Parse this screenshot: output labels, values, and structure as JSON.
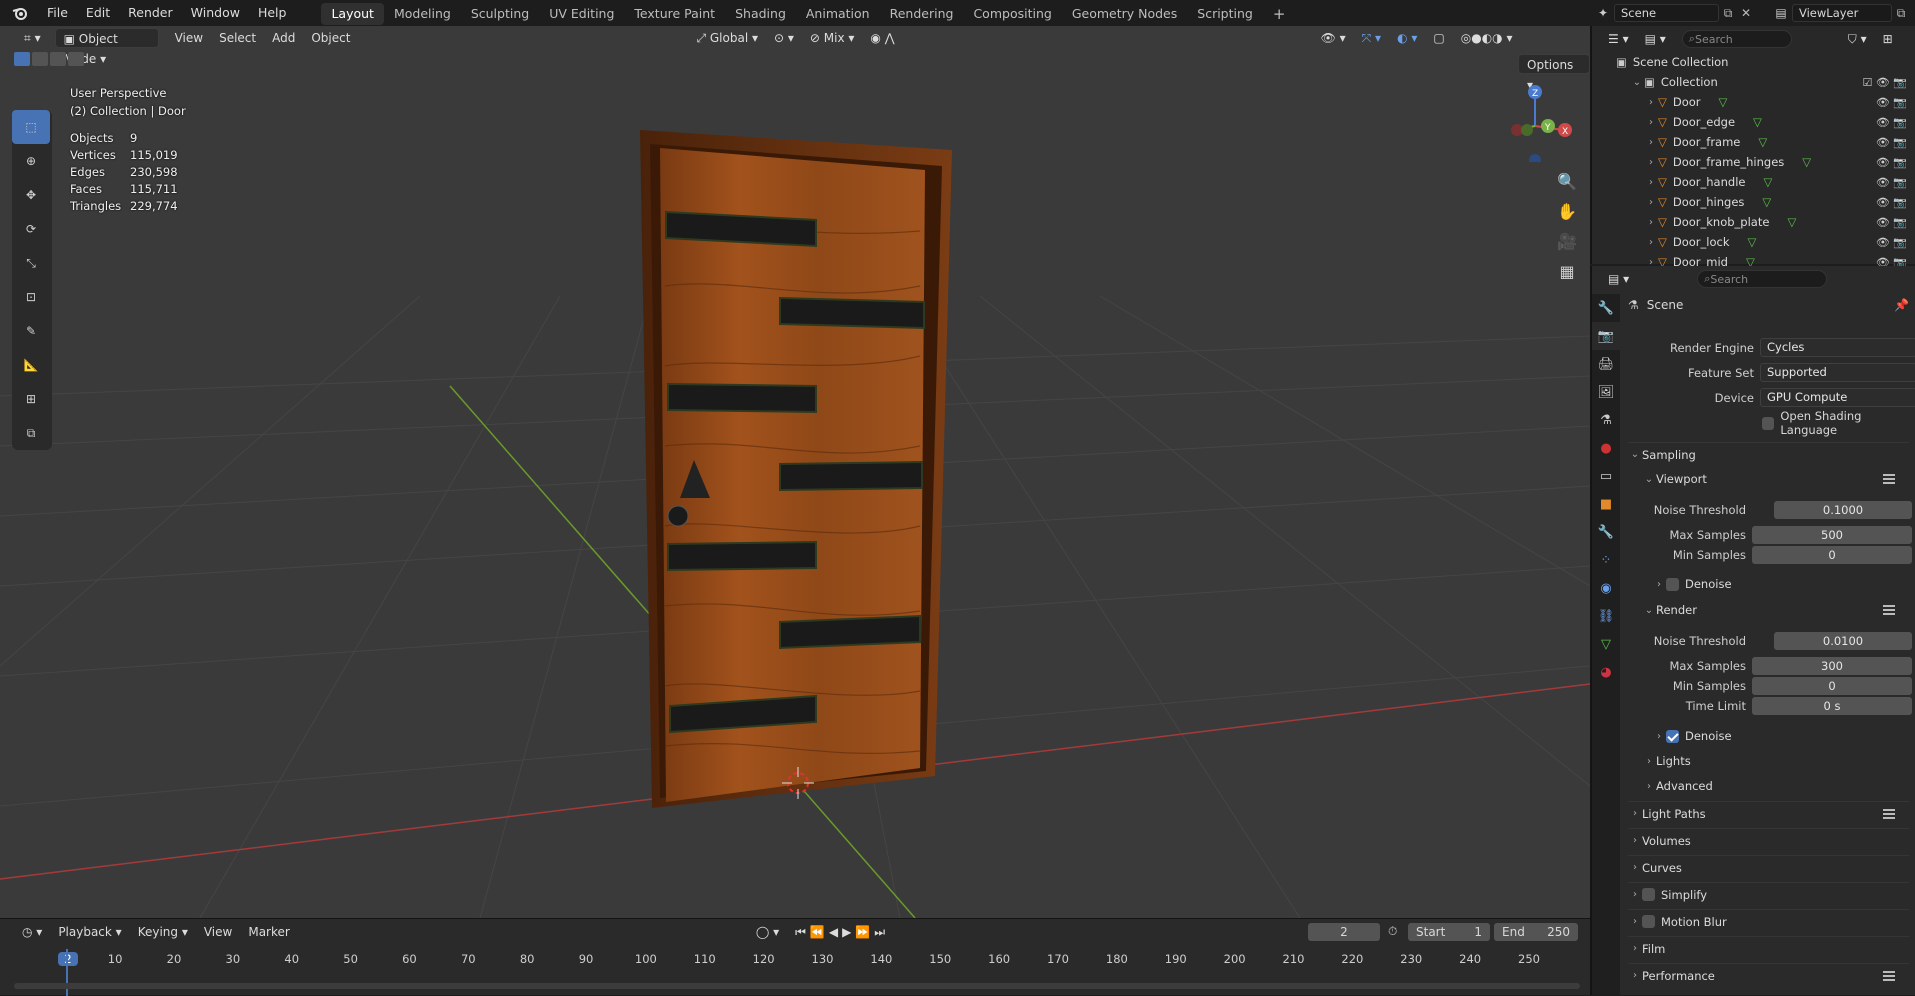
{
  "menu": {
    "items": [
      "File",
      "Edit",
      "Render",
      "Window",
      "Help"
    ]
  },
  "workspaces": {
    "tabs": [
      "Layout",
      "Modeling",
      "Sculpting",
      "UV Editing",
      "Texture Paint",
      "Shading",
      "Animation",
      "Rendering",
      "Compositing",
      "Geometry Nodes",
      "Scripting"
    ],
    "add": "+"
  },
  "scene": {
    "name": "Scene",
    "view_layer": "ViewLayer"
  },
  "viewport_header": {
    "mode": "Object Mode",
    "menus": [
      "View",
      "Select",
      "Add",
      "Object"
    ],
    "transform_orientation": "Global",
    "snap_mode": "Mix",
    "options": "Options"
  },
  "overlay_info": {
    "perspective": "User Perspective",
    "collection": "(2) Collection | Door",
    "stats": [
      {
        "label": "Objects",
        "value": "9"
      },
      {
        "label": "Vertices",
        "value": "115,019"
      },
      {
        "label": "Edges",
        "value": "230,598"
      },
      {
        "label": "Faces",
        "value": "115,711"
      },
      {
        "label": "Triangles",
        "value": "229,774"
      }
    ]
  },
  "gizmo": {
    "x": "X",
    "y": "Y",
    "z": "Z"
  },
  "timeline": {
    "menus": [
      "Playback",
      "Keying",
      "View",
      "Marker"
    ],
    "current_frame": "2",
    "start_label": "Start",
    "start": "1",
    "end_label": "End",
    "end": "250",
    "ticks": [
      "2",
      "10",
      "20",
      "30",
      "40",
      "50",
      "60",
      "70",
      "80",
      "90",
      "100",
      "110",
      "120",
      "130",
      "140",
      "150",
      "160",
      "170",
      "180",
      "190",
      "200",
      "210",
      "220",
      "230",
      "240",
      "250"
    ]
  },
  "outliner": {
    "search_placeholder": "Search",
    "root": "Scene Collection",
    "collection": "Collection",
    "objects": [
      "Door",
      "Door_edge",
      "Door_frame",
      "Door_frame_hinges",
      "Door_handle",
      "Door_hinges",
      "Door_knob_plate",
      "Door_lock",
      "Door_mid"
    ]
  },
  "properties": {
    "search_placeholder": "Search",
    "context": "Scene",
    "render_engine_label": "Render Engine",
    "render_engine": "Cycles",
    "feature_set_label": "Feature Set",
    "feature_set": "Supported",
    "device_label": "Device",
    "device": "GPU Compute",
    "osl_label": "Open Shading Language",
    "sampling": "Sampling",
    "viewport": "Viewport",
    "vp_noise_label": "Noise Threshold",
    "vp_noise": "0.1000",
    "vp_max_label": "Max Samples",
    "vp_max": "500",
    "vp_min_label": "Min Samples",
    "vp_min": "0",
    "vp_denoise": "Denoise",
    "render": "Render",
    "r_noise_label": "Noise Threshold",
    "r_noise": "0.0100",
    "r_max_label": "Max Samples",
    "r_max": "300",
    "r_min_label": "Min Samples",
    "r_min": "0",
    "r_time_label": "Time Limit",
    "r_time": "0 s",
    "r_denoise": "Denoise",
    "lights": "Lights",
    "advanced": "Advanced",
    "panels": [
      "Light Paths",
      "Volumes",
      "Curves",
      "Simplify",
      "Motion Blur",
      "Film",
      "Performance"
    ]
  }
}
